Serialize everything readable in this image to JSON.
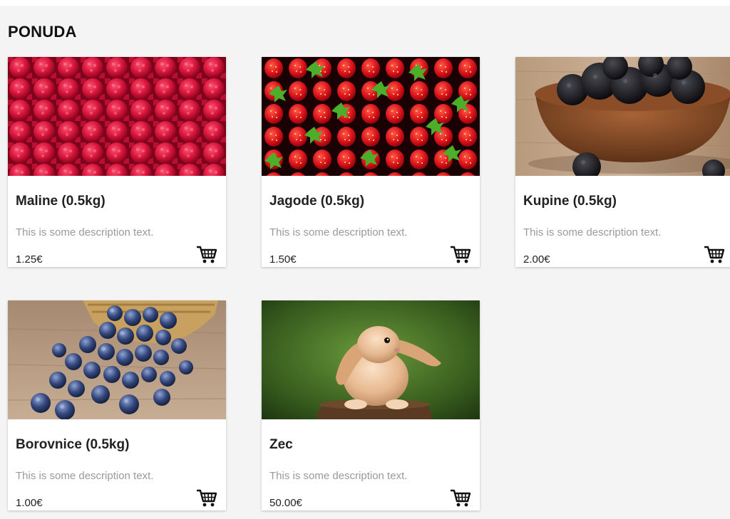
{
  "page": {
    "heading": "PONUDA"
  },
  "products": [
    {
      "title": "Maline (0.5kg)",
      "description": "This is some description text.",
      "price": "1.25€",
      "image": "raspberries-photo",
      "cart_icon": "shopping-cart-icon"
    },
    {
      "title": "Jagode (0.5kg)",
      "description": "This is some description text.",
      "price": "1.50€",
      "image": "strawberries-photo",
      "cart_icon": "shopping-cart-icon"
    },
    {
      "title": "Kupine (0.5kg)",
      "description": "This is some description text.",
      "price": "2.00€",
      "image": "blackberries-bowl-photo",
      "cart_icon": "shopping-cart-icon"
    },
    {
      "title": "Borovnice (0.5kg)",
      "description": "This is some description text.",
      "price": "1.00€",
      "image": "blueberries-basket-photo",
      "cart_icon": "shopping-cart-icon"
    },
    {
      "title": "Zec",
      "description": "This is some description text.",
      "price": "50.00€",
      "image": "rabbit-photo",
      "cart_icon": "shopping-cart-icon"
    }
  ],
  "colors": {
    "page_background": "#f4f4f4",
    "card_background": "#ffffff",
    "title_text": "#222222",
    "description_text": "#9a9a9a"
  }
}
